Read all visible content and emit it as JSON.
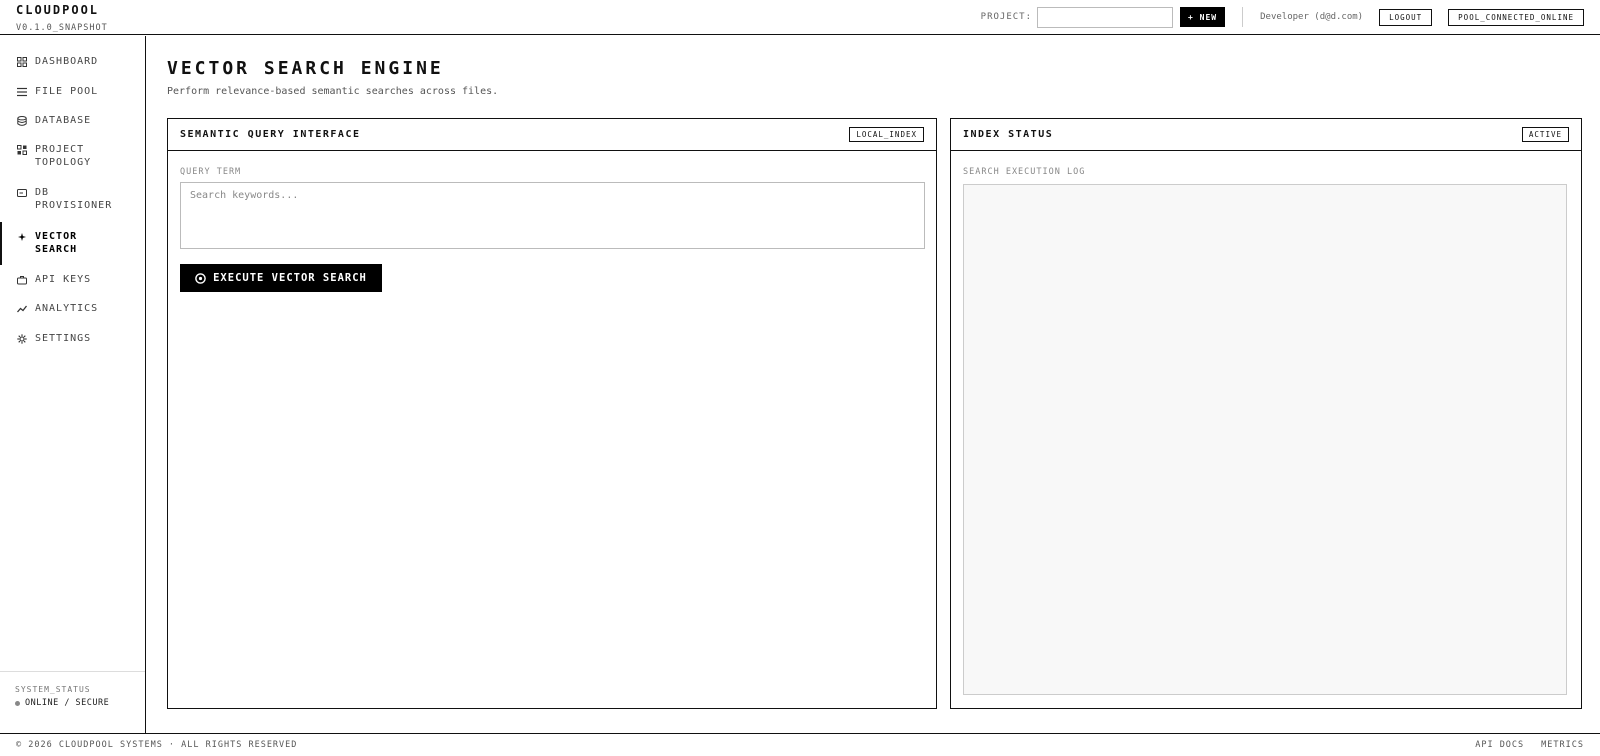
{
  "brand": {
    "name": "CLOUDPOOL",
    "version": "V0.1.0_SNAPSHOT"
  },
  "header": {
    "project_label": "PROJECT:",
    "project_value": "",
    "new_button": "+ NEW",
    "user": "Developer (d@d.com)",
    "logout": "LOGOUT",
    "status": "POOL_CONNECTED_ONLINE"
  },
  "sidebar": {
    "items": [
      {
        "label": "DASHBOARD",
        "icon": "grid-icon",
        "active": false
      },
      {
        "label": "FILE POOL",
        "icon": "list-icon",
        "active": false
      },
      {
        "label": "DATABASE",
        "icon": "database-icon",
        "active": false
      },
      {
        "label": "PROJECT TOPOLOGY",
        "icon": "topology-icon",
        "active": false
      },
      {
        "label": "DB PROVISIONER",
        "icon": "server-icon",
        "active": false
      },
      {
        "label": "VECTOR SEARCH",
        "icon": "sparkle-icon",
        "active": true
      },
      {
        "label": "API KEYS",
        "icon": "briefcase-icon",
        "active": false
      },
      {
        "label": "ANALYTICS",
        "icon": "trend-icon",
        "active": false
      },
      {
        "label": "SETTINGS",
        "icon": "gear-icon",
        "active": false
      }
    ],
    "status_label": "SYSTEM_STATUS",
    "status_value": "ONLINE / SECURE"
  },
  "main": {
    "title": "VECTOR SEARCH ENGINE",
    "subtitle": "Perform relevance-based semantic searches across files.",
    "query_panel": {
      "title": "SEMANTIC QUERY INTERFACE",
      "tag": "LOCAL_INDEX",
      "field_label": "QUERY TERM",
      "placeholder": "Search keywords...",
      "value": "",
      "button": "EXECUTE VECTOR SEARCH"
    },
    "index_panel": {
      "title": "INDEX STATUS",
      "tag": "ACTIVE",
      "log_label": "SEARCH EXECUTION LOG"
    }
  },
  "footer": {
    "copyright": "© 2026 CLOUDPOOL SYSTEMS · ALL RIGHTS RESERVED",
    "links": [
      "API DOCS",
      "METRICS"
    ]
  }
}
